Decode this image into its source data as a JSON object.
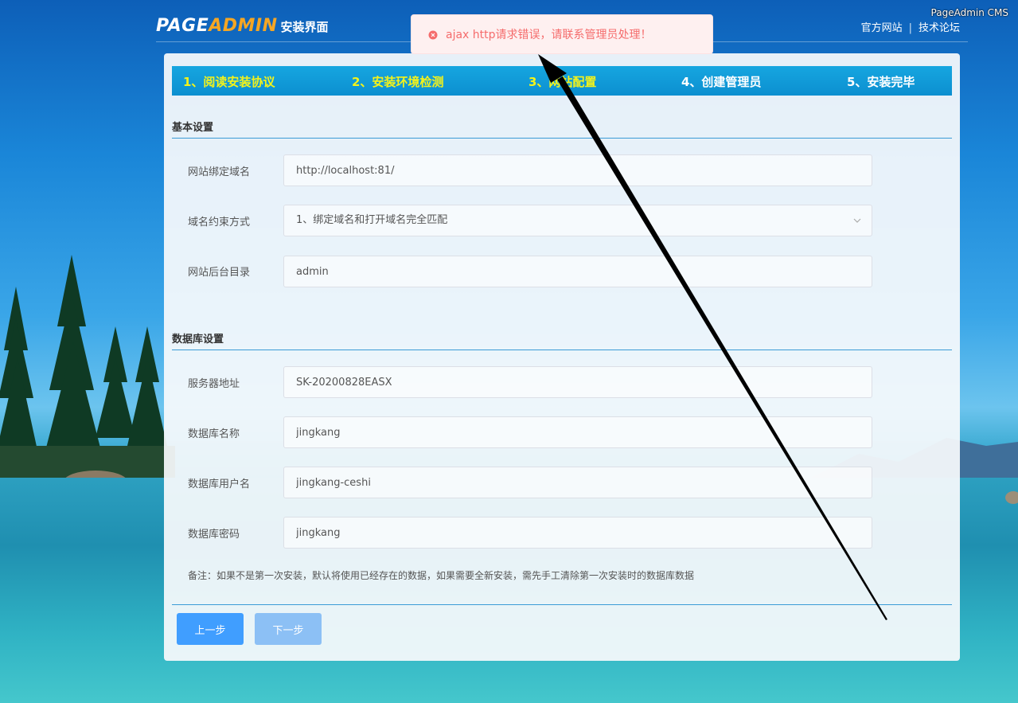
{
  "watermark": "PageAdmin CMS",
  "header": {
    "logo_page": "PAGE",
    "logo_admin": "ADMIN",
    "logo_sub": "安装界面",
    "links": [
      "官方网站",
      "技术论坛"
    ],
    "separator": "|"
  },
  "toast": {
    "message": "ajax http请求错误，请联系管理员处理！",
    "icon": "error-circle-icon",
    "color": "#f56c6c"
  },
  "steps": [
    {
      "label": "1、阅读安装协议",
      "done": true
    },
    {
      "label": "2、安装环境检测",
      "done": true
    },
    {
      "label": "3、网站配置",
      "done": true
    },
    {
      "label": "4、创建管理员",
      "done": false
    },
    {
      "label": "5、安装完毕",
      "done": false
    }
  ],
  "basic": {
    "title": "基本设置",
    "domain_label": "网站绑定域名",
    "domain_value": "http://localhost:81/",
    "match_label": "域名约束方式",
    "match_value": "1、绑定域名和打开域名完全匹配",
    "admin_dir_label": "网站后台目录",
    "admin_dir_value": "admin"
  },
  "database": {
    "title": "数据库设置",
    "server_label": "服务器地址",
    "server_value": "SK-20200828EASX",
    "name_label": "数据库名称",
    "name_value": "jingkang",
    "user_label": "数据库用户名",
    "user_value": "jingkang-ceshi",
    "password_label": "数据库密码",
    "password_value": "jingkang"
  },
  "note": "备注：如果不是第一次安装，默认将使用已经存在的数据，如果需要全新安装，需先手工清除第一次安装时的数据库数据",
  "buttons": {
    "prev": "上一步",
    "next": "下一步"
  },
  "colors": {
    "step_active": "#f4f31a",
    "step_bar": "#0c8fd0",
    "primary": "#409eff",
    "divider": "#3b9bd6"
  }
}
